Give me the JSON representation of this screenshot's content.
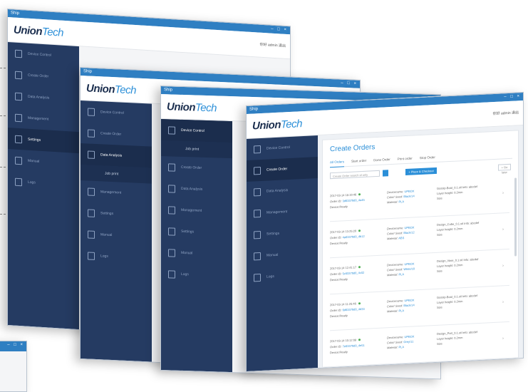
{
  "app": {
    "title": "Ship",
    "window_controls": "– □ ×",
    "logo_union": "Union",
    "logo_tech": "Tech",
    "user_text": "你好 admin  退出"
  },
  "sidebar": {
    "items": [
      {
        "label": "Device Control"
      },
      {
        "label": "Create Order"
      },
      {
        "label": "Data Analysis"
      },
      {
        "label": "Management"
      },
      {
        "label": "Settings"
      },
      {
        "label": "Manual"
      },
      {
        "label": "Logs"
      }
    ],
    "sub_item": "Job print"
  },
  "main": {
    "title": "Create Orders",
    "tabs": [
      "All Orders",
      "Start order",
      "Done Order",
      "Print order",
      "Stop Order"
    ],
    "filter_placeholder": "Create Order search id only",
    "primary_button": "+ Place & Checkout",
    "secondary_button": "+ Go later",
    "orders": [
      {
        "date": "2017-03-14 18:19:46",
        "order_label": "Order ID:",
        "order_id": "3d63379d0_4a45",
        "status": "Device:Ready",
        "dev_label": "Devicename:",
        "dev_value": "UPBOX",
        "color_label": "Color/ Seed:",
        "color_value": "Black/14",
        "material_label": "Material:",
        "material_value": "PLA",
        "file": "Gossip-Boat_0.1.stl Info: abcdef",
        "layer": "Layer height: 0.2mm",
        "size": "Size"
      },
      {
        "date": "2017-03-14 13:25:20",
        "order_label": "Order ID:",
        "order_id": "4a63379d0_4b12",
        "status": "Device:Ready",
        "dev_label": "Devicename:",
        "dev_value": "UPBOX",
        "color_label": "Color/ Seed:",
        "color_value": "Black/12",
        "material_label": "Material:",
        "material_value": "ABS",
        "file": "Design_Cube_0.1.stl Info: abcdef",
        "layer": "Layer height: 0.2mm",
        "size": "Size"
      },
      {
        "date": "2017-03-14 12:41:17",
        "order_label": "Order ID:",
        "order_id": "5c63379d0_4c02",
        "status": "Device:Ready",
        "dev_label": "Devicename:",
        "dev_value": "UPBOX",
        "color_label": "Color/ Seed:",
        "color_value": "White/10",
        "material_label": "Material:",
        "material_value": "PLA",
        "file": "Design_Vase_0.1.stl Info: abcdef",
        "layer": "Layer height: 0.2mm",
        "size": "Size"
      },
      {
        "date": "2017-03-14 11:25:46",
        "order_label": "Order ID:",
        "order_id": "6d63379d0_4d33",
        "status": "Device:Ready",
        "dev_label": "Devicename:",
        "dev_value": "UPBOX",
        "color_label": "Color/ Seed:",
        "color_value": "Black/14",
        "material_label": "Material:",
        "material_value": "PLA",
        "file": "Gossip-Boat_0.1.stl Info: abcdef",
        "layer": "Layer height: 0.2mm",
        "size": "Size"
      },
      {
        "date": "2017-03-14 10:12:08",
        "order_label": "Order ID:",
        "order_id": "7e63379d0_4e51",
        "status": "Device:Ready",
        "dev_label": "Devicename:",
        "dev_value": "UPBOX",
        "color_label": "Color/ Seed:",
        "color_value": "Grey/11",
        "material_label": "Material:",
        "material_value": "PLA",
        "file": "Design_Part_0.1.stl Info: abcdef",
        "layer": "Layer height: 0.2mm",
        "size": "Size"
      }
    ]
  },
  "colors": {
    "accent": "#2b8fd8",
    "sidebar": "#253b62",
    "titlebar": "#2f7fc2"
  }
}
